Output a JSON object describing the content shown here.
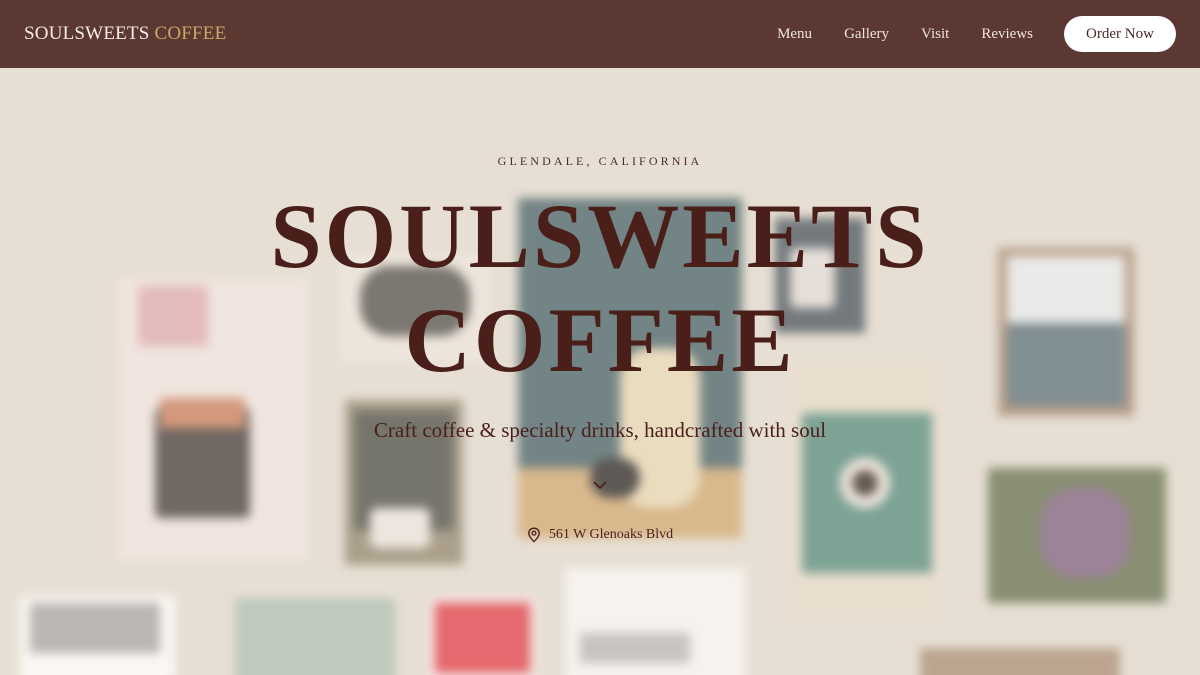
{
  "header": {
    "brand_primary": "SOULSWEETS",
    "brand_secondary": "COFFEE",
    "nav": [
      "Menu",
      "Gallery",
      "Visit",
      "Reviews"
    ],
    "cta_label": "Order Now"
  },
  "hero": {
    "eyebrow": "GLENDALE, CALIFORNIA",
    "title_line1": "SOULSWEETS",
    "title_line2": "COFFEE",
    "tagline": "Craft coffee & specialty drinks, handcrafted with soul",
    "scroll_icon": "chevron-down-icon",
    "address_icon": "map-pin-icon",
    "address": "561 W Glenoaks Blvd"
  },
  "colors": {
    "header_bg": "#5b3832",
    "brand_accent": "#c9a76a",
    "title_text": "#4a1f1a",
    "cta_bg": "#ffffff"
  }
}
